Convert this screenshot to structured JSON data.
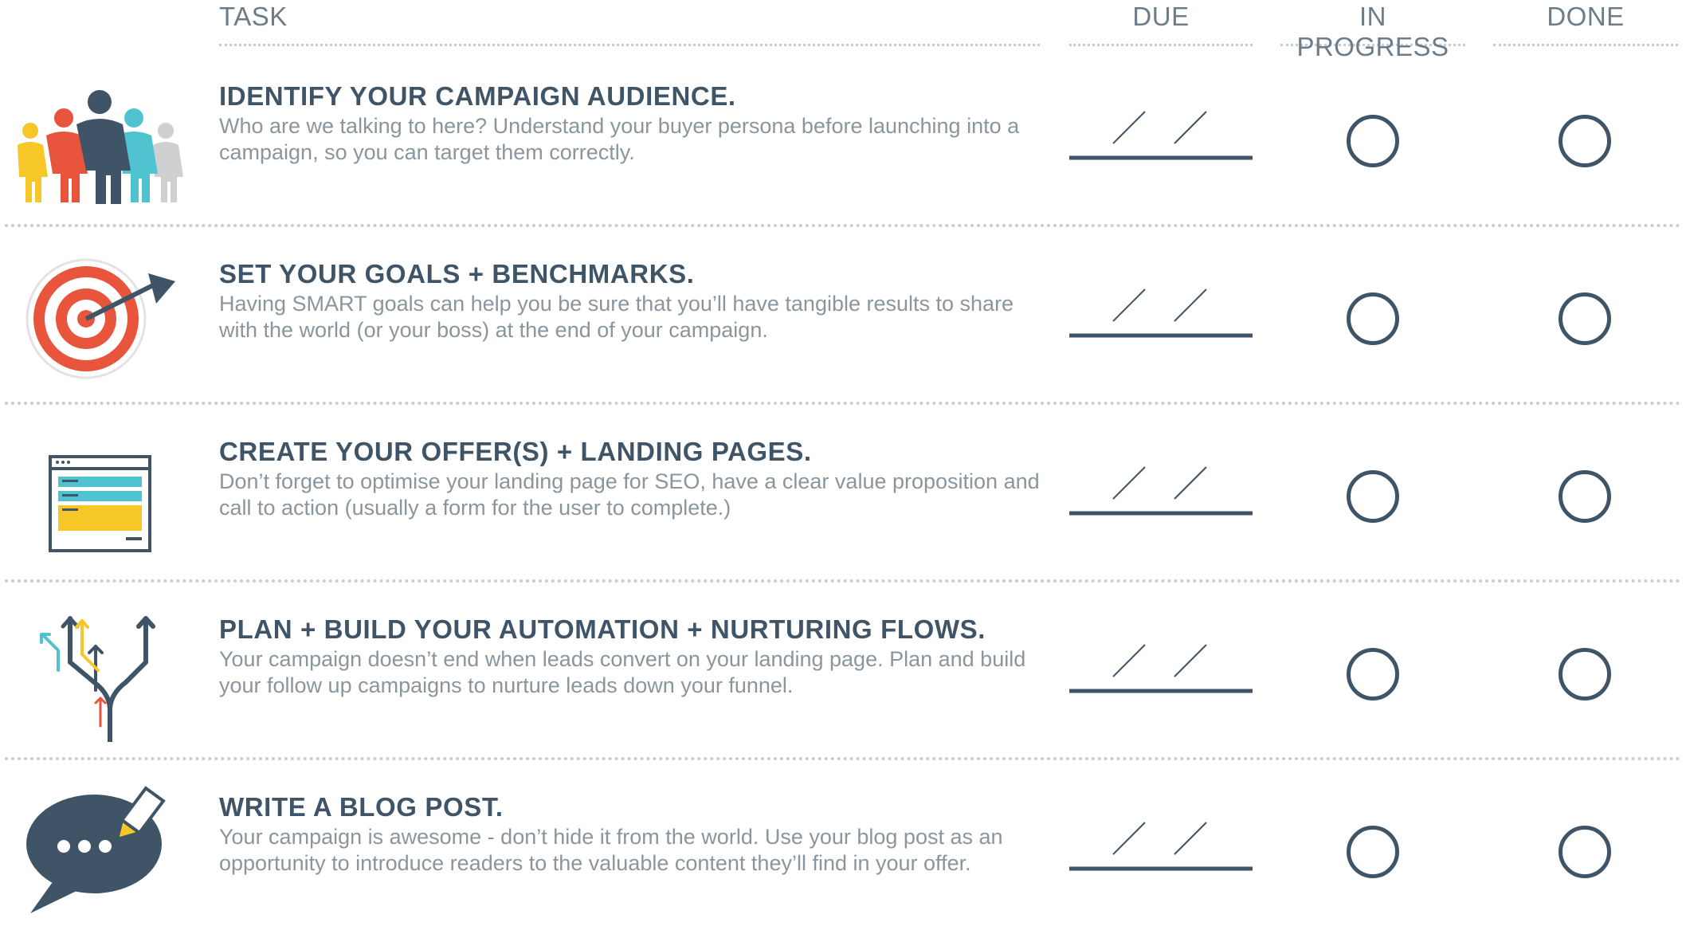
{
  "header": {
    "task": "TASK",
    "due": "DUE",
    "in_progress": "IN PROGRESS",
    "done": "DONE"
  },
  "tasks": [
    {
      "title": "IDENTIFY YOUR CAMPAIGN AUDIENCE.",
      "description": "Who are we talking to here? Understand your buyer persona before launching into a campaign, so you can target them correctly.",
      "icon": "audience-people-icon"
    },
    {
      "title": "SET YOUR GOALS + BENCHMARKS.",
      "description": "Having SMART goals can help you be sure that you’ll have tangible results to share with the world (or your boss) at the end of your campaign.",
      "icon": "target-icon"
    },
    {
      "title": "CREATE YOUR OFFER(S) + LANDING PAGES.",
      "description": "Don’t forget to optimise your landing page for SEO, have a clear value proposition and call to action (usually a form for the user to complete.)",
      "icon": "landing-page-icon"
    },
    {
      "title": "PLAN + BUILD YOUR AUTOMATION + NURTURING FLOWS.",
      "description": "Your campaign doesn’t end when leads convert on your landing page. Plan and build your follow up campaigns to nurture leads down your funnel.",
      "icon": "branching-arrows-icon"
    },
    {
      "title": "WRITE A BLOG POST.",
      "description": "Your campaign is awesome - don’t hide it from the world. Use your blog post as an opportunity to introduce readers to the valuable content they’ll find in your offer.",
      "icon": "speech-bubble-pen-icon"
    }
  ],
  "colors": {
    "dark": "#3f5567",
    "muted": "#8a959e",
    "orange": "#e8543c",
    "yellow": "#f6c726",
    "teal": "#4fc3cf",
    "grey": "#cfcfcf"
  }
}
